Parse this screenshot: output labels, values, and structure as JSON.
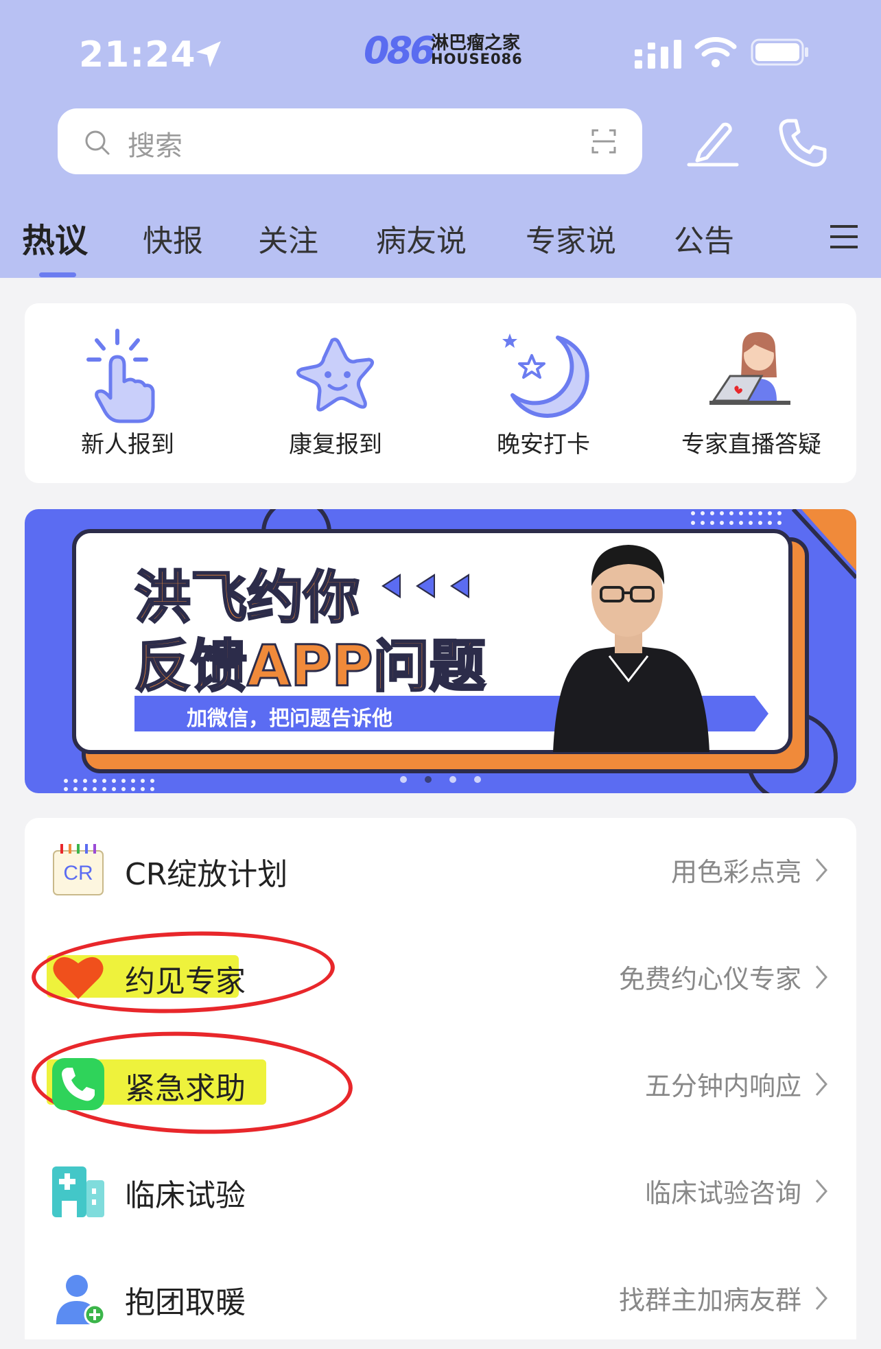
{
  "status_bar": {
    "time": "21:24"
  },
  "logo": {
    "number": "086",
    "name_cn": "淋巴瘤之家",
    "name_en": "HOUSE086"
  },
  "search": {
    "placeholder": "搜索"
  },
  "tabs": [
    {
      "label": "热议",
      "active": true
    },
    {
      "label": "快报"
    },
    {
      "label": "关注"
    },
    {
      "label": "病友说"
    },
    {
      "label": "专家说"
    },
    {
      "label": "公告"
    }
  ],
  "quick_actions": [
    {
      "label": "新人报到",
      "icon": "tap-hand-icon"
    },
    {
      "label": "康复报到",
      "icon": "star-face-icon"
    },
    {
      "label": "晚安打卡",
      "icon": "moon-star-icon"
    },
    {
      "label": "专家直播答疑",
      "icon": "girl-laptop-icon"
    }
  ],
  "banner": {
    "line1": "洪飞约你",
    "line2": "反馈APP问题",
    "subtitle": "加微信，把问题告诉他",
    "page_count": 4,
    "active_page": 2
  },
  "menu_rows": [
    {
      "title": "CR绽放计划",
      "subtitle": "用色彩点亮",
      "icon": "cr-calendar-icon"
    },
    {
      "title": "约见专家",
      "subtitle": "免费约心仪专家",
      "icon": "heart-icon"
    },
    {
      "title": "紧急求助",
      "subtitle": "五分钟内响应",
      "icon": "phone-icon"
    },
    {
      "title": "临床试验",
      "subtitle": "临床试验咨询",
      "icon": "hospital-icon"
    },
    {
      "title": "抱团取暖",
      "subtitle": "找群主加病友群",
      "icon": "add-user-icon"
    }
  ],
  "colors": {
    "header": "#b8c1f3",
    "accent": "#6b7cf0",
    "banner_orange": "#f08a3a",
    "banner_blue": "#5b6cf2"
  }
}
